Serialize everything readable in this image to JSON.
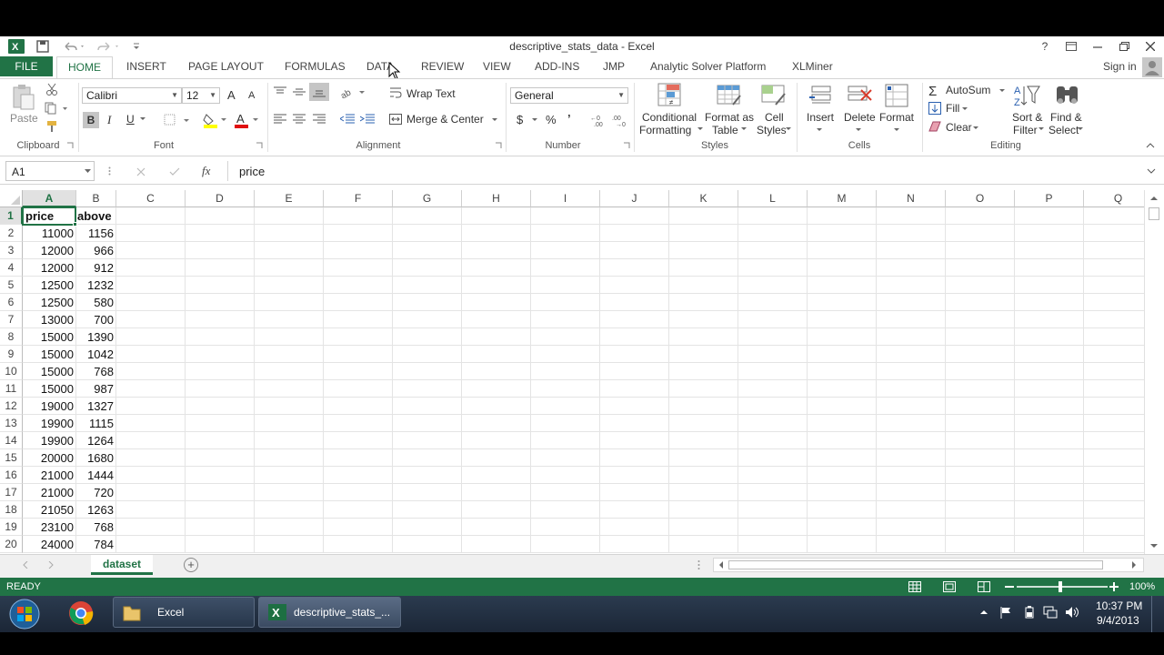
{
  "window": {
    "title": "descriptive_stats_data - Excel",
    "help": "?",
    "signin": "Sign in"
  },
  "tabs": [
    "FILE",
    "HOME",
    "INSERT",
    "PAGE LAYOUT",
    "FORMULAS",
    "DATA",
    "REVIEW",
    "VIEW",
    "ADD-INS",
    "JMP",
    "Analytic Solver Platform",
    "XLMiner"
  ],
  "ribbon": {
    "clipboard": {
      "paste": "Paste",
      "label": "Clipboard"
    },
    "font": {
      "name": "Calibri",
      "size": "12",
      "bold": "B",
      "italic": "I",
      "underline": "U",
      "grow": "A",
      "shrink": "A",
      "label": "Font"
    },
    "alignment": {
      "wrap": "Wrap Text",
      "merge": "Merge & Center",
      "label": "Alignment"
    },
    "number": {
      "format": "General",
      "currency": "$",
      "percent": "%",
      "comma": "’",
      "label": "Number"
    },
    "styles": {
      "cond1": "Conditional",
      "cond2": "Formatting",
      "fmt1": "Format as",
      "fmt2": "Table",
      "cell1": "Cell",
      "cell2": "Styles",
      "label": "Styles"
    },
    "cells": {
      "insert": "Insert",
      "delete": "Delete",
      "format": "Format",
      "label": "Cells"
    },
    "editing": {
      "autosum": "AutoSum",
      "fill": "Fill",
      "clear": "Clear",
      "sort1": "Sort &",
      "sort2": "Filter",
      "find1": "Find &",
      "find2": "Select",
      "label": "Editing"
    }
  },
  "formula_bar": {
    "namebox": "A1",
    "fx": "fx",
    "content": "price"
  },
  "columns": [
    "A",
    "B",
    "C",
    "D",
    "E",
    "F",
    "G",
    "H",
    "I",
    "J",
    "K",
    "L",
    "M",
    "N",
    "O",
    "P",
    "Q"
  ],
  "rows": [
    {
      "n": "1",
      "a": "price",
      "b": "above"
    },
    {
      "n": "2",
      "a": "11000",
      "b": "1156"
    },
    {
      "n": "3",
      "a": "12000",
      "b": "966"
    },
    {
      "n": "4",
      "a": "12000",
      "b": "912"
    },
    {
      "n": "5",
      "a": "12500",
      "b": "1232"
    },
    {
      "n": "6",
      "a": "12500",
      "b": "580"
    },
    {
      "n": "7",
      "a": "13000",
      "b": "700"
    },
    {
      "n": "8",
      "a": "15000",
      "b": "1390"
    },
    {
      "n": "9",
      "a": "15000",
      "b": "1042"
    },
    {
      "n": "10",
      "a": "15000",
      "b": "768"
    },
    {
      "n": "11",
      "a": "15000",
      "b": "987"
    },
    {
      "n": "12",
      "a": "19000",
      "b": "1327"
    },
    {
      "n": "13",
      "a": "19900",
      "b": "1115"
    },
    {
      "n": "14",
      "a": "19900",
      "b": "1264"
    },
    {
      "n": "15",
      "a": "20000",
      "b": "1680"
    },
    {
      "n": "16",
      "a": "21000",
      "b": "1444"
    },
    {
      "n": "17",
      "a": "21000",
      "b": "720"
    },
    {
      "n": "18",
      "a": "21050",
      "b": "1263"
    },
    {
      "n": "19",
      "a": "23100",
      "b": "768"
    },
    {
      "n": "20",
      "a": "24000",
      "b": "784"
    }
  ],
  "sheet": {
    "tab": "dataset",
    "add": "+"
  },
  "status": {
    "text": "READY",
    "zoom": "100%"
  },
  "taskbar": {
    "app1": "Excel",
    "app2": "descriptive_stats_...",
    "time": "10:37 PM",
    "date": "9/4/2013"
  }
}
